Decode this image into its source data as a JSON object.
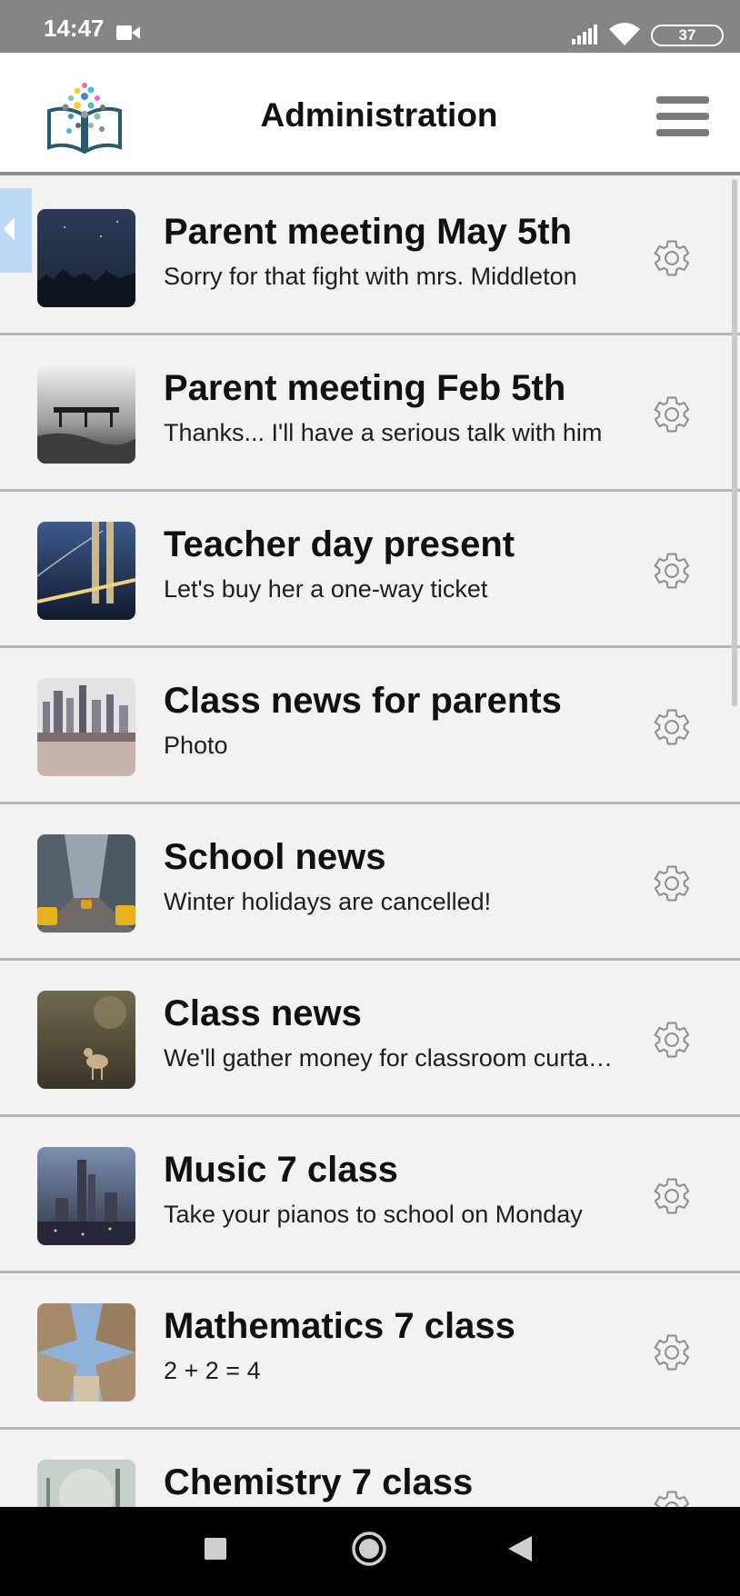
{
  "status_bar": {
    "time": "14:47",
    "battery": "37",
    "icons": [
      "video-icon",
      "signal-icon",
      "wifi-icon",
      "battery-icon"
    ]
  },
  "header": {
    "title": "Administration",
    "logo_icon": "book-logo-icon",
    "menu_icon": "hamburger-menu-icon"
  },
  "list": {
    "items": [
      {
        "title": "Parent meeting May 5th",
        "subtitle": "Sorry for that fight with mrs. Middleton"
      },
      {
        "title": "Parent meeting Feb 5th",
        "subtitle": "Thanks... I'll have a serious talk with him"
      },
      {
        "title": "Teacher day present",
        "subtitle": "Let's buy her a one-way ticket"
      },
      {
        "title": "Class news for parents",
        "subtitle": "Photo"
      },
      {
        "title": "School news",
        "subtitle": "Winter holidays are cancelled!"
      },
      {
        "title": "Class news",
        "subtitle": "We'll gather money for classroom curtains"
      },
      {
        "title": "Music 7 class",
        "subtitle": "Take your pianos to school on Monday"
      },
      {
        "title": "Mathematics 7 class",
        "subtitle": "2 + 2 = 4"
      },
      {
        "title": "Chemistry 7 class",
        "subtitle": ""
      }
    ],
    "item_action_icon": "gear-icon"
  },
  "nav_bar": {
    "icons": [
      "recents-icon",
      "home-icon",
      "back-icon"
    ]
  },
  "colors": {
    "status_bar": "#858585",
    "header_bg": "#ffffff",
    "list_bg": "#f2f2f2",
    "divider": "#b6b6b6",
    "nav_bar": "#000000",
    "drawer_tab": "#bcd8f5"
  }
}
